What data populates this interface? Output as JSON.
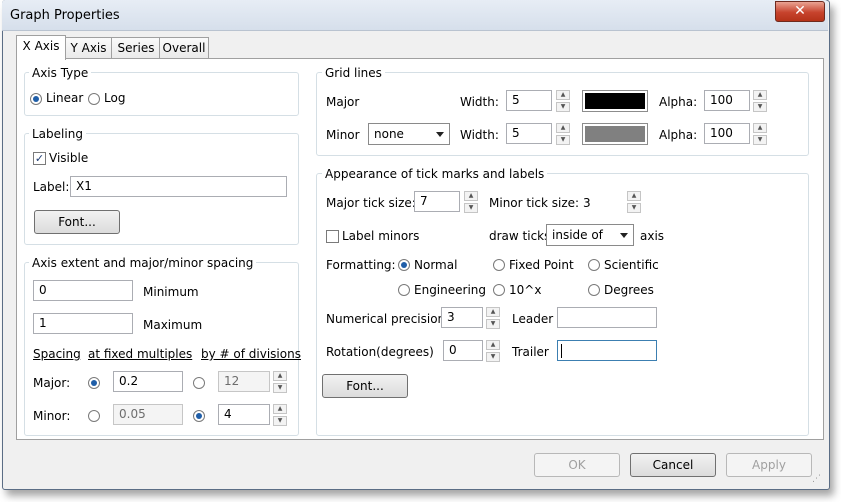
{
  "window": {
    "title": "Graph Properties",
    "close": "✕"
  },
  "tabs": [
    "X Axis",
    "Y Axis",
    "Series",
    "Overall"
  ],
  "axis_type": {
    "title": "Axis Type",
    "linear": "Linear",
    "log": "Log",
    "selected": "Linear"
  },
  "labeling": {
    "title": "Labeling",
    "visible": "Visible",
    "visible_checked": true,
    "label": "Label:",
    "label_value": "X1",
    "font_button": "Font..."
  },
  "extent": {
    "title": "Axis extent and major/minor spacing",
    "min_value": "0",
    "min_label": "Minimum",
    "max_value": "1",
    "max_label": "Maximum",
    "spacing": "Spacing",
    "fixed": "at fixed multiples",
    "divisions": "by # of divisions",
    "major_label": "Major:",
    "major_fixed": "0.2",
    "major_div": "12",
    "minor_label": "Minor:",
    "minor_fixed": "0.05",
    "minor_div": "4"
  },
  "grid": {
    "title": "Grid lines",
    "major": "Major",
    "minor": "Minor",
    "minor_select": "none",
    "width": "Width:",
    "alpha": "Alpha:",
    "major_width": "5",
    "minor_width": "5",
    "major_alpha": "100",
    "minor_alpha": "100",
    "major_color": "#000000",
    "minor_color": "#808080"
  },
  "ticks": {
    "title": "Appearance of tick marks and labels",
    "major_size_label": "Major tick size:",
    "major_size": "7",
    "minor_size_label": "Minor tick size:",
    "minor_size": "3",
    "label_minors": "Label minors",
    "draw_ticks": "draw ticks",
    "draw_select": "inside of",
    "axis": "axis",
    "formatting": "Formatting:",
    "normal": "Normal",
    "fixed_point": "Fixed Point",
    "scientific": "Scientific",
    "engineering": "Engineering",
    "ten_x": "10^x",
    "degrees": "Degrees",
    "precision_label": "Numerical precision",
    "precision": "3",
    "leader": "Leader",
    "rotation_label": "Rotation(degrees)",
    "rotation": "0",
    "trailer": "Trailer",
    "font_button": "Font..."
  },
  "footer": {
    "ok": "OK",
    "cancel": "Cancel",
    "apply": "Apply"
  }
}
